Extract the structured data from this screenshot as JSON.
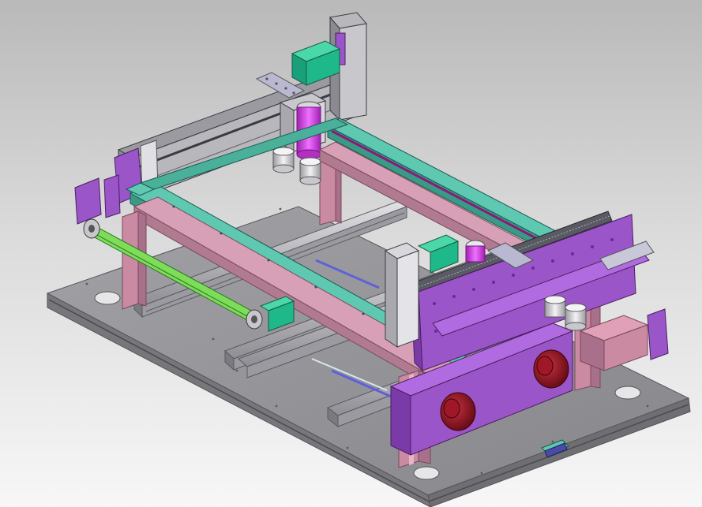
{
  "viewport": {
    "background_top": "#b9b9b9",
    "background_bottom": "#f7f7f7"
  },
  "model": {
    "components": [
      "base-plate",
      "lower-aluminum-rails",
      "gantry-frame-front-beam",
      "gantry-frame-rear-beam",
      "vertical-pink-posts",
      "z-axis-column",
      "x-axis-linear-module",
      "stepper-motors",
      "magenta-spindle",
      "purple-side-panel",
      "purple-linear-module",
      "green-belt-drive",
      "red-motor-couplings",
      "cup-holders"
    ],
    "colors": {
      "plate": "#8f8f93",
      "plate_edge": "#6b6b70",
      "teal": "#5fc8b0",
      "pink": "#c98aa2",
      "purple": "#9a55c8",
      "violet": "#b06be0",
      "magenta": "#d43fe0",
      "green": "#1fb88a",
      "belt": "#7fdc5a",
      "red": "#8a1018",
      "aluminum": "#b4b4b8",
      "rail_dark": "#3a3a44",
      "steel": "#d8d8dc",
      "blue_rod": "#6060d8"
    }
  }
}
